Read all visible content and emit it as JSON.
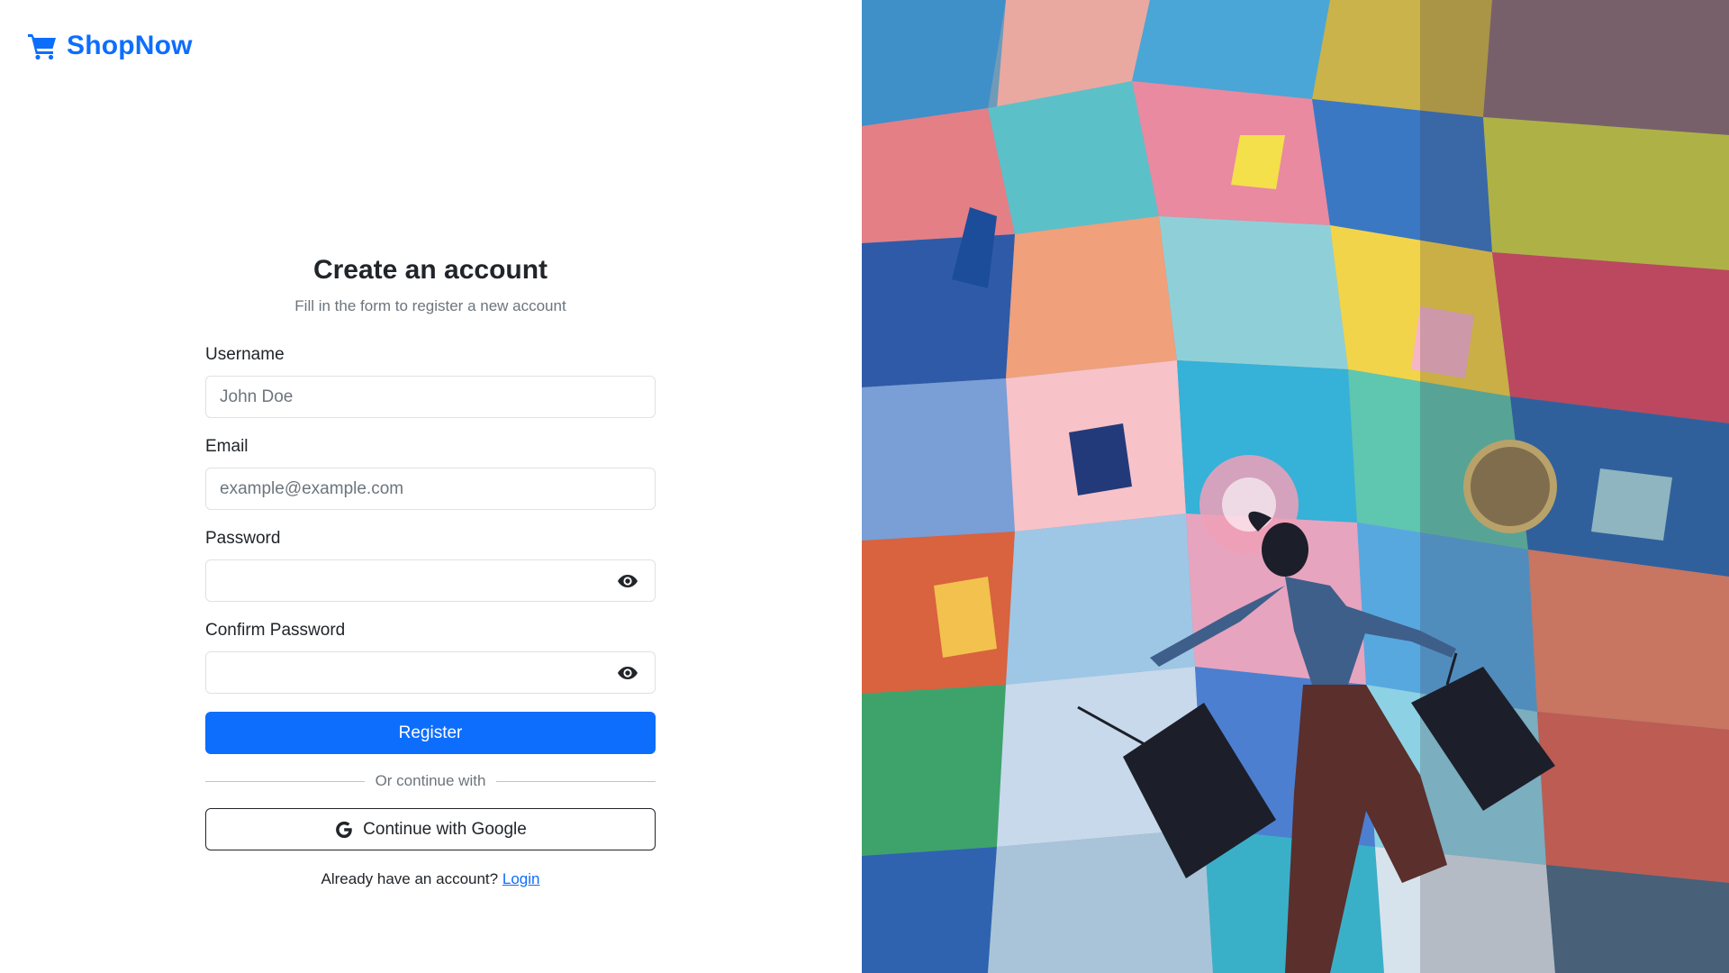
{
  "brand": {
    "name": "ShopNow",
    "icon": "shopping-cart-icon",
    "color": "#0d6efd"
  },
  "form": {
    "title": "Create an account",
    "subtitle": "Fill in the form to register a new account",
    "username": {
      "label": "Username",
      "placeholder": "John Doe",
      "value": ""
    },
    "email": {
      "label": "Email",
      "placeholder": "example@example.com",
      "value": ""
    },
    "password": {
      "label": "Password",
      "value": "",
      "toggle_icon": "eye-icon"
    },
    "confirm_password": {
      "label": "Confirm Password",
      "value": "",
      "toggle_icon": "eye-icon"
    },
    "register_label": "Register",
    "divider_text": "Or continue with",
    "google_label": "Continue with Google",
    "google_icon": "google-g-icon",
    "login_prompt": "Already have an account?",
    "login_link": "Login"
  },
  "hero_image": {
    "description_icon": "mural-photo"
  },
  "colors": {
    "primary": "#0d6efd",
    "text": "#212529",
    "muted": "#6c757d",
    "border": "#dee2e6"
  }
}
